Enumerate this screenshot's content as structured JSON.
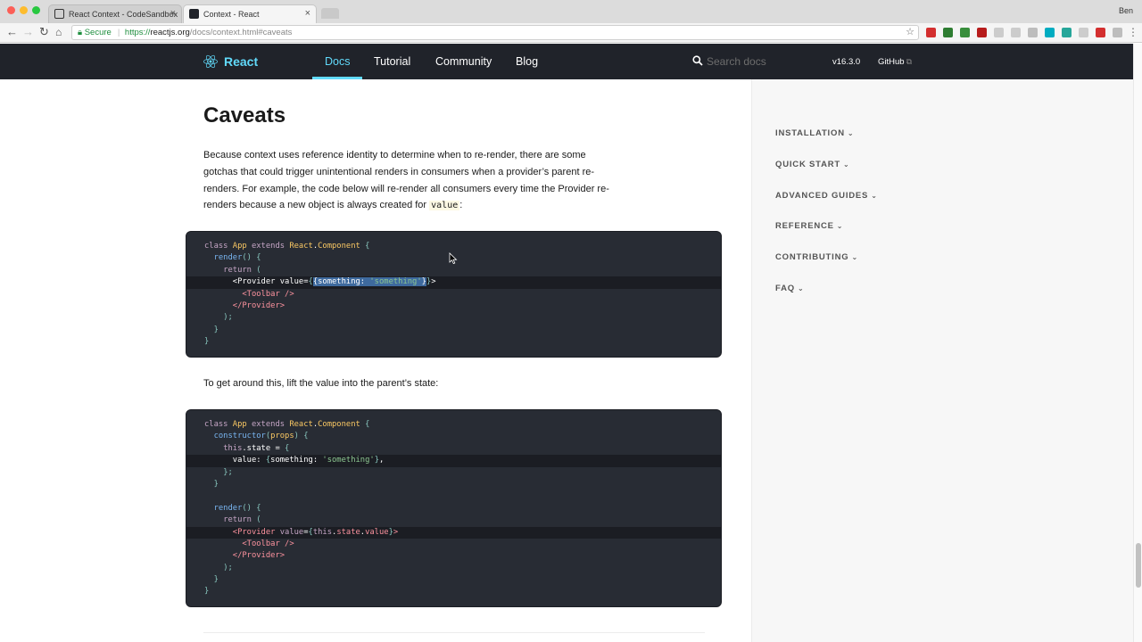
{
  "browser": {
    "tabs": [
      {
        "title": "React Context - CodeSandbox",
        "active": false
      },
      {
        "title": "Context - React",
        "active": true
      }
    ],
    "user_name": "Ben",
    "url": {
      "secure_label": "Secure",
      "scheme": "https://",
      "host": "reactjs.org",
      "path": "/docs/context.html#caveats"
    },
    "extension_colors": [
      "#d32f2f",
      "#2e7d32",
      "#388e3c",
      "#b71c1c",
      "#cccccc",
      "#cccccc",
      "#bdbdbd",
      "#00acc1",
      "#26a69a",
      "#cccccc",
      "#d32f2f",
      "#bdbdbd"
    ]
  },
  "header": {
    "logo_text": "React",
    "nav": [
      {
        "label": "Docs",
        "active": true
      },
      {
        "label": "Tutorial",
        "active": false
      },
      {
        "label": "Community",
        "active": false
      },
      {
        "label": "Blog",
        "active": false
      }
    ],
    "search_placeholder": "Search docs",
    "version": "v16.3.0",
    "github_label": "GitHub",
    "accent_color": "#61dafb",
    "bg_color": "#20232a"
  },
  "content": {
    "title": "Caveats",
    "para1_lines": [
      "Because context uses reference identity to determine when to re-render, there are some",
      "gotchas that could trigger unintentional renders in consumers when a provider’s parent re-",
      "renders. For example, the code below will re-render all consumers every time the Provider re-",
      "renders because a new object is always created for "
    ],
    "para1_code": "value",
    "para1_end": ":",
    "para2": "To get around this, lift the value into the parent’s state:"
  },
  "sidebar": {
    "items": [
      {
        "label": "INSTALLATION"
      },
      {
        "label": "QUICK START"
      },
      {
        "label": "ADVANCED GUIDES"
      },
      {
        "label": "REFERENCE"
      },
      {
        "label": "CONTRIBUTING"
      },
      {
        "label": "FAQ"
      }
    ]
  }
}
